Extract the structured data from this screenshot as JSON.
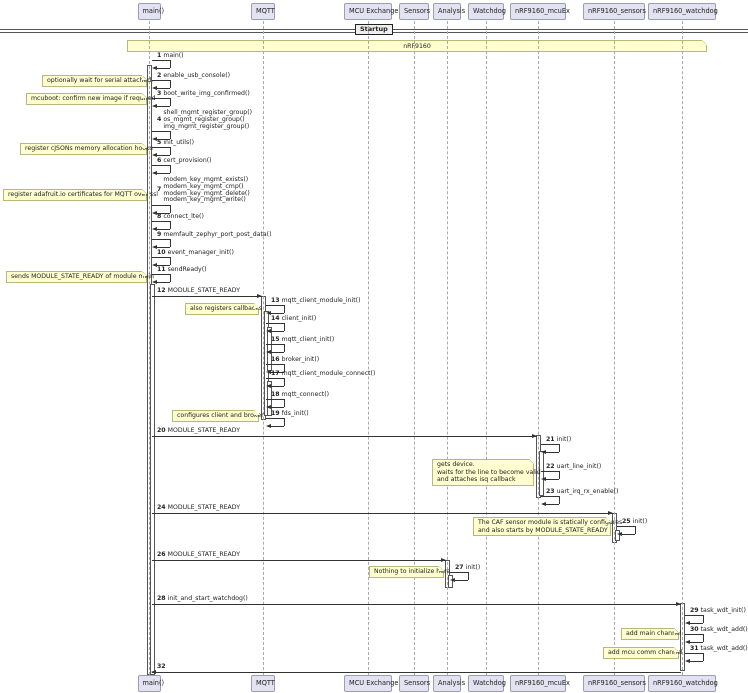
{
  "participants": [
    {
      "id": "main",
      "label": "main()"
    },
    {
      "id": "mqtt",
      "label": "MQTT"
    },
    {
      "id": "mcuexchange",
      "label": "MCU Exchange"
    },
    {
      "id": "sensors",
      "label": "Sensors"
    },
    {
      "id": "analysis",
      "label": "Analysis"
    },
    {
      "id": "watchdog",
      "label": "Watchdog"
    },
    {
      "id": "nrf_mcuex",
      "label": "nRF9160_mcuEx"
    },
    {
      "id": "nrf_sensors",
      "label": "nRF9160_sensors"
    },
    {
      "id": "nrf_watchdog",
      "label": "nRF9160_watchdog"
    }
  ],
  "divider": {
    "label": "Startup"
  },
  "group_note": {
    "label": "nRF9160"
  },
  "messages": [
    {
      "n": "1",
      "lines": [
        "main()"
      ],
      "from": "main",
      "to": "main"
    },
    {
      "n": "2",
      "lines": [
        "enable_usb_console()"
      ],
      "from": "main",
      "to": "main"
    },
    {
      "n": "3",
      "lines": [
        "boot_write_img_confirmed()"
      ],
      "from": "main",
      "to": "main"
    },
    {
      "n": "4",
      "lines": [
        "shell_mgmt_register_group()",
        "os_mgmt_register_group()",
        "img_mgmt_register_group()"
      ],
      "from": "main",
      "to": "main"
    },
    {
      "n": "5",
      "lines": [
        "init_utils()"
      ],
      "from": "main",
      "to": "main"
    },
    {
      "n": "6",
      "lines": [
        "cert_provision()"
      ],
      "from": "main",
      "to": "main"
    },
    {
      "n": "7",
      "lines": [
        "modem_key_mgmt_exists()",
        "modem_key_mgmt_cmp()",
        "modem_key_mgmt_delete()",
        "modem_key_mgmt_write()"
      ],
      "from": "main",
      "to": "main"
    },
    {
      "n": "8",
      "lines": [
        "connect_lte()"
      ],
      "from": "main",
      "to": "main"
    },
    {
      "n": "9",
      "lines": [
        "memfault_zephyr_port_post_data()"
      ],
      "from": "main",
      "to": "main"
    },
    {
      "n": "10",
      "lines": [
        "event_manager_init()"
      ],
      "from": "main",
      "to": "main"
    },
    {
      "n": "11",
      "lines": [
        "sendReady()"
      ],
      "from": "main",
      "to": "main"
    },
    {
      "n": "12",
      "lines": [
        "MODULE_STATE_READY"
      ],
      "from": "main",
      "to": "mqtt"
    },
    {
      "n": "13",
      "lines": [
        "mqtt_client_module_init()"
      ],
      "from": "mqtt",
      "to": "mqtt"
    },
    {
      "n": "14",
      "lines": [
        "client_init()"
      ],
      "from": "mqtt",
      "to": "mqtt"
    },
    {
      "n": "15",
      "lines": [
        "mqtt_client_init()"
      ],
      "from": "mqtt",
      "to": "mqtt"
    },
    {
      "n": "16",
      "lines": [
        "broker_init()"
      ],
      "from": "mqtt",
      "to": "mqtt"
    },
    {
      "n": "17",
      "lines": [
        "mqtt_client_module_connect()"
      ],
      "from": "mqtt",
      "to": "mqtt"
    },
    {
      "n": "18",
      "lines": [
        "mqtt_connect()"
      ],
      "from": "mqtt",
      "to": "mqtt"
    },
    {
      "n": "19",
      "lines": [
        "fds_init()"
      ],
      "from": "mqtt",
      "to": "mqtt"
    },
    {
      "n": "20",
      "lines": [
        "MODULE_STATE_READY"
      ],
      "from": "main",
      "to": "nrf_mcuex"
    },
    {
      "n": "21",
      "lines": [
        "init()"
      ],
      "from": "nrf_mcuex",
      "to": "nrf_mcuex"
    },
    {
      "n": "22",
      "lines": [
        "uart_line_init()"
      ],
      "from": "nrf_mcuex",
      "to": "nrf_mcuex"
    },
    {
      "n": "23",
      "lines": [
        "uart_irq_rx_enable()"
      ],
      "from": "nrf_mcuex",
      "to": "nrf_mcuex"
    },
    {
      "n": "24",
      "lines": [
        "MODULE_STATE_READY"
      ],
      "from": "main",
      "to": "nrf_sensors"
    },
    {
      "n": "25",
      "lines": [
        "init()"
      ],
      "from": "nrf_sensors",
      "to": "nrf_sensors"
    },
    {
      "n": "26",
      "lines": [
        "MODULE_STATE_READY"
      ],
      "from": "main",
      "to": "analysis"
    },
    {
      "n": "27",
      "lines": [
        "init()"
      ],
      "from": "analysis",
      "to": "analysis"
    },
    {
      "n": "28",
      "lines": [
        "init_and_start_watchdog()"
      ],
      "from": "main",
      "to": "nrf_watchdog"
    },
    {
      "n": "29",
      "lines": [
        "task_wdt_init()"
      ],
      "from": "nrf_watchdog",
      "to": "nrf_watchdog"
    },
    {
      "n": "30",
      "lines": [
        "task_wdt_add()"
      ],
      "from": "nrf_watchdog",
      "to": "nrf_watchdog"
    },
    {
      "n": "31",
      "lines": [
        "task_wdt_add()"
      ],
      "from": "nrf_watchdog",
      "to": "nrf_watchdog"
    },
    {
      "n": "32",
      "lines": [
        ""
      ],
      "from": "nrf_watchdog",
      "to": "main"
    }
  ],
  "notes": [
    {
      "lines": [
        "optionally wait for serial attached."
      ]
    },
    {
      "lines": [
        "mcuboot: confirm new image if required"
      ]
    },
    {
      "lines": [
        "register cJSONs memory allocation hooks"
      ]
    },
    {
      "lines": [
        "register adafruit.io certificates for MQTT over ssl"
      ]
    },
    {
      "lines": [
        "sends MODULE_STATE_READY of module main"
      ]
    },
    {
      "lines": [
        "also registers callbacks"
      ]
    },
    {
      "lines": [
        "configures client and broker"
      ]
    },
    {
      "lines": [
        "gets device.",
        "waits for the line to become valid",
        "and attaches isq callback"
      ]
    },
    {
      "lines": [
        "The CAF sensor module is statically configures",
        "and also starts by MODULE_STATE_READY"
      ]
    },
    {
      "lines": [
        "Nothing to initialize here"
      ]
    },
    {
      "lines": [
        "add main channel"
      ]
    },
    {
      "lines": [
        "add mcu comm channel"
      ]
    }
  ]
}
